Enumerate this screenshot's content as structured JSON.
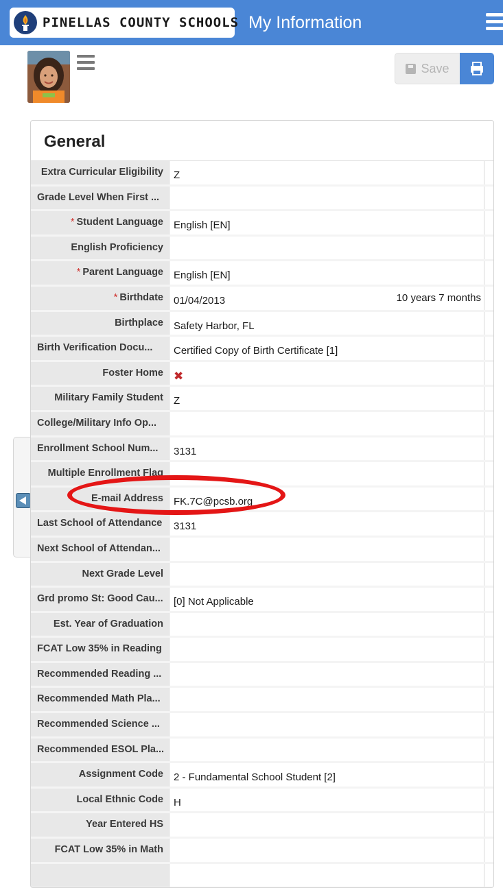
{
  "header": {
    "logo_text": "PINELLAS COUNTY SCHOOLS",
    "title": "My Information",
    "menu_icon": "hamburger-menu-icon"
  },
  "toolbar": {
    "save_label": "Save",
    "save_icon": "floppy-disk-icon",
    "print_icon": "printer-icon",
    "student_menu_icon": "hamburger-menu-icon"
  },
  "panel": {
    "title": "General",
    "rows": [
      {
        "label": "Extra Curricular Eligibility",
        "value": "Z"
      },
      {
        "label": "Grade Level When First ...",
        "value": ""
      },
      {
        "label": "Student Language",
        "value": "English [EN]",
        "required": true
      },
      {
        "label": "English Proficiency",
        "value": ""
      },
      {
        "label": "Parent Language",
        "value": "English [EN]",
        "required": true
      },
      {
        "label": "Birthdate",
        "value": "01/04/2013",
        "extra": "10 years 7 months",
        "required": true
      },
      {
        "label": "Birthplace",
        "value": "Safety Harbor, FL"
      },
      {
        "label": "Birth Verification Docu...",
        "value": "Certified Copy of Birth Certificate [1]"
      },
      {
        "label": "Foster Home",
        "value": "",
        "icon": "x-mark-icon"
      },
      {
        "label": "Military Family Student",
        "value": "Z"
      },
      {
        "label": "College/Military Info Op...",
        "value": ""
      },
      {
        "label": "Enrollment School Num...",
        "value": "3131"
      },
      {
        "label": "Multiple Enrollment Flag",
        "value": ""
      },
      {
        "label": "E-mail Address",
        "value": "FK.7C@pcsb.org"
      },
      {
        "label": "Last School of Attendance",
        "value": "3131"
      },
      {
        "label": "Next School of Attendan...",
        "value": ""
      },
      {
        "label": "Next Grade Level",
        "value": ""
      },
      {
        "label": "Grd promo St: Good Cau...",
        "value": "[0] Not Applicable"
      },
      {
        "label": "Est. Year of Graduation",
        "value": ""
      },
      {
        "label": "FCAT Low 35% in Reading",
        "value": ""
      },
      {
        "label": "Recommended Reading ...",
        "value": ""
      },
      {
        "label": "Recommended Math Pla...",
        "value": ""
      },
      {
        "label": "Recommended Science ...",
        "value": ""
      },
      {
        "label": "Recommended ESOL Pla...",
        "value": ""
      },
      {
        "label": "Assignment Code",
        "value": "2 - Fundamental School Student [2]"
      },
      {
        "label": "Local Ethnic Code",
        "value": "H"
      },
      {
        "label": "Year Entered HS",
        "value": ""
      },
      {
        "label": "FCAT Low 35% in Math",
        "value": ""
      },
      {
        "label": "",
        "value": ""
      }
    ]
  },
  "colors": {
    "header_blue": "#4a86d6",
    "annotation_red": "#e41616",
    "label_bg": "#e8e8e8"
  }
}
